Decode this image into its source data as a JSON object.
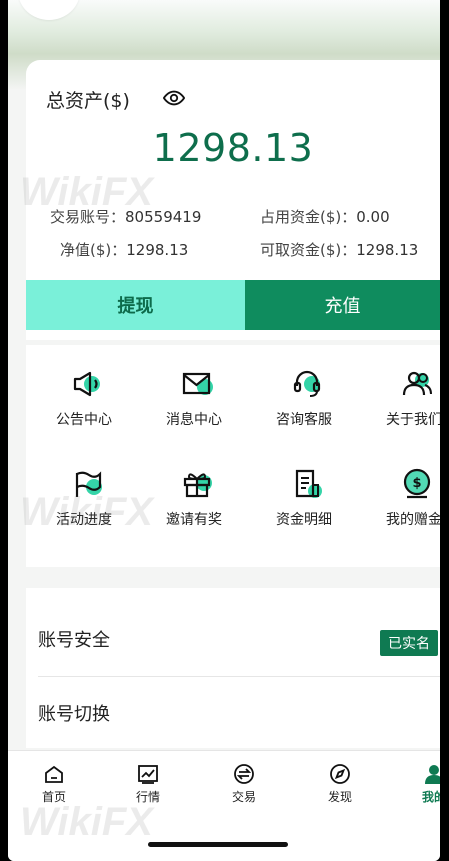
{
  "assets": {
    "title": "总资产($)",
    "total": "1298.13",
    "account_label": "交易账号：",
    "account_value": "80559419",
    "margin_label": "占用资金($)：",
    "margin_value": "0.00",
    "equity_label": "净值($)：",
    "equity_value": "1298.13",
    "available_label": "可取资金($)：",
    "available_value": "1298.13",
    "withdraw_label": "提现",
    "deposit_label": "充值"
  },
  "menu": {
    "items": [
      {
        "label": "公告中心",
        "icon": "megaphone-icon"
      },
      {
        "label": "消息中心",
        "icon": "envelope-icon"
      },
      {
        "label": "咨询客服",
        "icon": "headset-icon"
      },
      {
        "label": "关于我们",
        "icon": "users-icon"
      },
      {
        "label": "活动进度",
        "icon": "flag-icon"
      },
      {
        "label": "邀请有奖",
        "icon": "gift-icon"
      },
      {
        "label": "资金明细",
        "icon": "document-icon"
      },
      {
        "label": "我的赠金",
        "icon": "coin-icon"
      }
    ]
  },
  "settings": {
    "security_label": "账号安全",
    "verified_badge": "已实名",
    "switch_label": "账号切换"
  },
  "tabbar": {
    "items": [
      {
        "label": "首页",
        "icon": "home-icon"
      },
      {
        "label": "行情",
        "icon": "chart-icon"
      },
      {
        "label": "交易",
        "icon": "exchange-icon"
      },
      {
        "label": "发现",
        "icon": "compass-icon"
      },
      {
        "label": "我的",
        "icon": "profile-icon"
      }
    ],
    "active_index": 4
  },
  "watermark": {
    "text": "WikiFX"
  },
  "colors": {
    "accent_dark": "#0f7a52",
    "accent_light": "#7af0d9",
    "total_value": "#0e6e4c"
  }
}
